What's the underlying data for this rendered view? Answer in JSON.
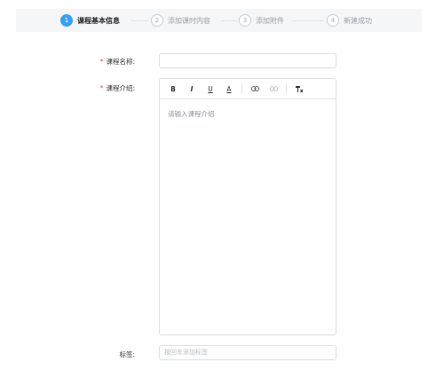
{
  "steps": [
    {
      "num": "1",
      "label": "课程基本信息"
    },
    {
      "num": "2",
      "label": "添加课时内容"
    },
    {
      "num": "3",
      "label": "添加附件"
    },
    {
      "num": "4",
      "label": "新建成功"
    }
  ],
  "form": {
    "required_mark": "*",
    "course_name_label": "课程名称:",
    "course_name_value": "",
    "course_intro_label": "课程介绍:",
    "editor_placeholder": "请输入课程介绍",
    "tags_label": "标签:",
    "tags_placeholder": "按回车添加标签"
  },
  "toolbar": {
    "bold": "B",
    "italic": "I",
    "underline": "U",
    "font_color": "A"
  },
  "colors": {
    "accent": "#3aa0f0",
    "required": "#e54c3c"
  }
}
